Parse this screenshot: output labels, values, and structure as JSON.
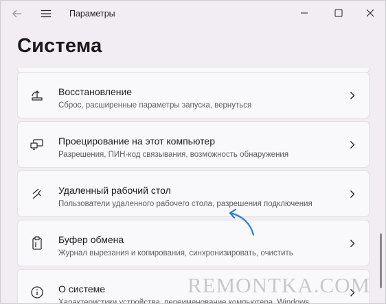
{
  "window": {
    "title": "Параметры",
    "controls": {
      "minimize_icon": "minimize-icon",
      "maximize_icon": "maximize-icon",
      "close_icon": "close-icon"
    }
  },
  "page": {
    "title": "Система"
  },
  "items": [
    {
      "icon": "restore-icon",
      "title": "Восстановление",
      "subtitle": "Сброс, расширенные параметры запуска, вернуться"
    },
    {
      "icon": "projection-icon",
      "title": "Проецирование на этот компьютер",
      "subtitle": "Разрешения, ПИН-код связывания, возможность обнаружения"
    },
    {
      "icon": "remote-desktop-icon",
      "title": "Удаленный рабочий стол",
      "subtitle": "Пользователи удаленного рабочего стола, разрешения подключения"
    },
    {
      "icon": "clipboard-icon",
      "title": "Буфер обмена",
      "subtitle": "Журнал вырезания и копирования, синхронизировать, очистить"
    },
    {
      "icon": "info-icon",
      "title": "О системе",
      "subtitle": "Характеристики устройства, переименование компьютера, Windows"
    }
  ],
  "watermark": "REMONTKA.COM",
  "colors": {
    "background": "#f1edf3",
    "card": "#f9f8fa",
    "annotation_arrow": "#2b7ad6"
  }
}
